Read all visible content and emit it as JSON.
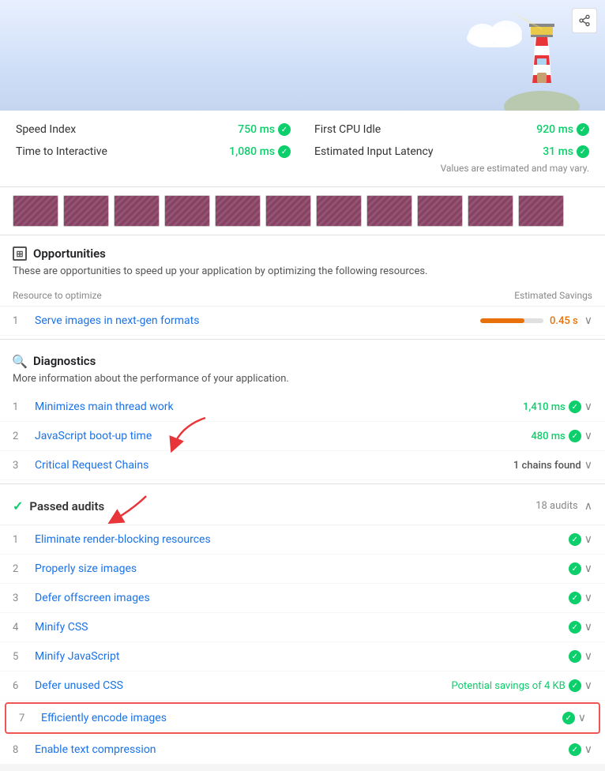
{
  "header": {
    "share_label": "share"
  },
  "metrics": [
    {
      "label": "Speed Index",
      "value": "750 ms",
      "pass": true
    },
    {
      "label": "First CPU Idle",
      "value": "920 ms",
      "pass": true
    },
    {
      "label": "Time to Interactive",
      "value": "1,080 ms",
      "pass": true
    },
    {
      "label": "Estimated Input Latency",
      "value": "31 ms",
      "pass": true
    }
  ],
  "values_note": "Values are estimated and may vary.",
  "opportunities": {
    "title": "Opportunities",
    "description": "These are opportunities to speed up your application by optimizing the following resources.",
    "col_resource": "Resource to optimize",
    "col_savings": "Estimated Savings",
    "items": [
      {
        "num": "1",
        "label": "Serve images in next-gen formats",
        "savings_value": "0.45 s",
        "bar_pct": 70
      }
    ]
  },
  "diagnostics": {
    "title": "Diagnostics",
    "description": "More information about the performance of your application.",
    "items": [
      {
        "num": "1",
        "label": "Minimizes main thread work",
        "value": "1,410 ms",
        "type": "warn"
      },
      {
        "num": "2",
        "label": "JavaScript boot-up time",
        "value": "480 ms",
        "type": "warn"
      },
      {
        "num": "3",
        "label": "Critical Request Chains",
        "value": "1 chains found",
        "type": "neutral"
      }
    ]
  },
  "passed_audits": {
    "title": "Passed audits",
    "count": "18 audits",
    "items": [
      {
        "num": "1",
        "label": "Eliminate render-blocking resources",
        "highlighted": false
      },
      {
        "num": "2",
        "label": "Properly size images",
        "highlighted": false
      },
      {
        "num": "3",
        "label": "Defer offscreen images",
        "highlighted": false
      },
      {
        "num": "4",
        "label": "Minify CSS",
        "highlighted": false
      },
      {
        "num": "5",
        "label": "Minify JavaScript",
        "highlighted": false
      },
      {
        "num": "6",
        "label": "Defer unused CSS",
        "potential_savings": "Potential savings of 4 KB",
        "highlighted": false
      },
      {
        "num": "7",
        "label": "Efficiently encode images",
        "highlighted": true
      },
      {
        "num": "8",
        "label": "Enable text compression",
        "highlighted": false
      }
    ]
  }
}
